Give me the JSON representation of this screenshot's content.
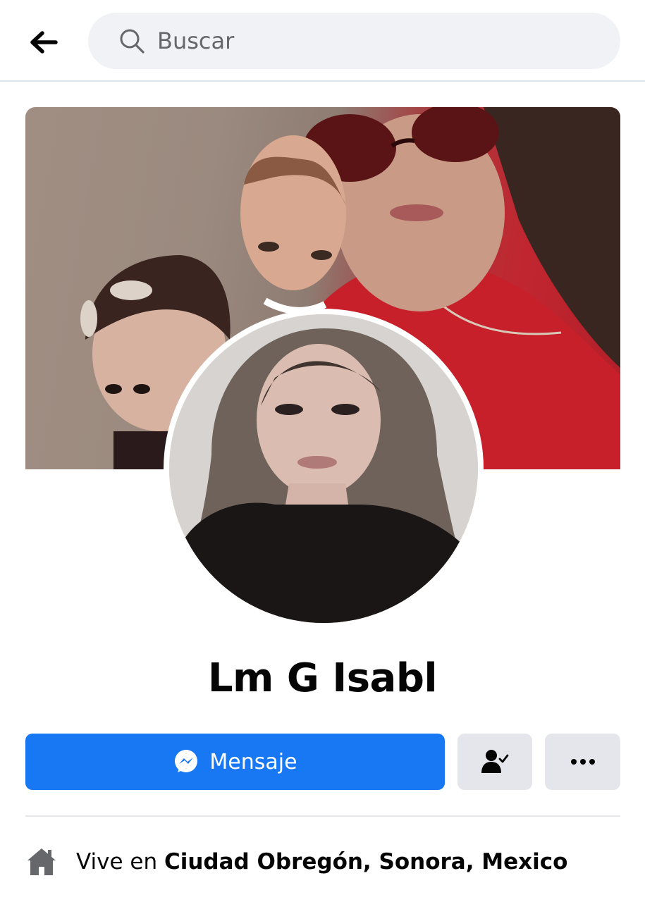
{
  "search": {
    "placeholder": "Buscar"
  },
  "profile": {
    "name": "Lm G Isabl",
    "cover_photo": "family-selfie-cover",
    "profile_photo": "woman-portrait"
  },
  "actions": {
    "message_label": "Mensaje",
    "friends_icon": "friends-check-icon",
    "more_icon": "more-dots-icon"
  },
  "intro": {
    "lives_prefix": "Vive en ",
    "lives_place": "Ciudad Obregón, Sonora, Mexico"
  },
  "colors": {
    "primary": "#1877f2",
    "secondary_button": "#e4e6eb",
    "search_background": "#f0f2f5",
    "text": "#050505",
    "muted": "#65676b"
  }
}
